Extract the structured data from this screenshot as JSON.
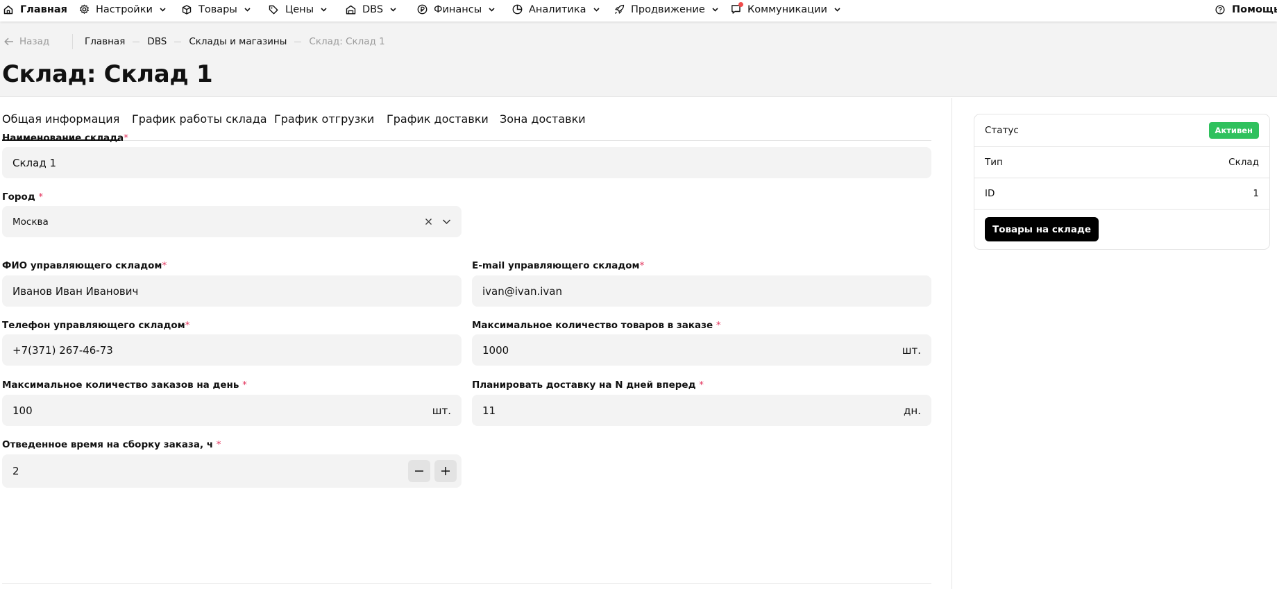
{
  "nav": {
    "home": "Главная",
    "settings": "Настройки",
    "products": "Товары",
    "prices": "Цены",
    "dbs": "DBS",
    "finance": "Финансы",
    "analytics": "Аналитика",
    "promotion": "Продвижение",
    "communications": "Коммуникации",
    "help": "Помощь"
  },
  "header": {
    "back": "Назад",
    "breadcrumbs": [
      "Главная",
      "DBS",
      "Склады и магазины",
      "Склад: Склад 1"
    ],
    "title": "Склад: Склад 1"
  },
  "tabs": [
    "Общая информация",
    "График работы склада",
    "График отгрузки",
    "График доставки",
    "Зона доставки"
  ],
  "form": {
    "name": {
      "label": "Наименование склада",
      "value": "Склад 1"
    },
    "city": {
      "label": "Город ",
      "value": "Москва"
    },
    "manager_name": {
      "label": "ФИО управляющего складом",
      "value": "Иванов Иван Иванович"
    },
    "manager_email": {
      "label": "E-mail управляющего складом",
      "value": "ivan@ivan.ivan"
    },
    "manager_phone": {
      "label": "Телефон управляющего складом",
      "value": "+7(371) 267-46-73"
    },
    "max_items": {
      "label": "Максимальное количество товаров в заказе ",
      "value": "1000",
      "unit": "шт."
    },
    "max_orders": {
      "label": "Максимальное количество заказов на день ",
      "value": "100",
      "unit": "шт."
    },
    "plan_days": {
      "label": "Планировать доставку на N дней вперед ",
      "value": "11",
      "unit": "дн."
    },
    "assembly_time": {
      "label": "Отведенное время на сборку заказа, ч ",
      "value": "2"
    },
    "required_mark": "*"
  },
  "panel": {
    "status_label": "Статус",
    "status_value": "Активен",
    "type_label": "Тип",
    "type_value": "Склад",
    "id_label": "ID",
    "id_value": "1",
    "button": "Товары на складе"
  },
  "colors": {
    "accent": "#111111",
    "required": "#e3335c",
    "status_active": "#2fc15d",
    "notification": "#f04b4b"
  }
}
